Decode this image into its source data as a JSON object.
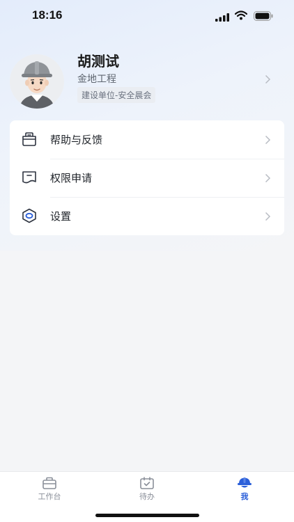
{
  "status_bar": {
    "time": "18:16",
    "icons": [
      "signal-icon",
      "wifi-icon",
      "battery-icon"
    ]
  },
  "profile": {
    "name": "胡测试",
    "company": "金地工程",
    "role": "建设单位-安全晨会",
    "avatar": "worker-avatar-with-helmet"
  },
  "menu": {
    "items": [
      {
        "label": "帮助与反馈",
        "icon": "feedback-icon"
      },
      {
        "label": "权限申请",
        "icon": "permission-icon"
      },
      {
        "label": "设置",
        "icon": "settings-icon"
      }
    ]
  },
  "tabbar": {
    "tabs": [
      {
        "label": "工作台",
        "icon": "workbench-icon",
        "active": false
      },
      {
        "label": "待办",
        "icon": "todo-icon",
        "active": false
      },
      {
        "label": "我",
        "icon": "helmet-icon",
        "active": true
      }
    ]
  },
  "colors": {
    "accent": "#2b5fd9",
    "text_primary": "#1f2329",
    "text_secondary": "#5f6670",
    "background": "#f4f5f7",
    "card": "#ffffff"
  }
}
